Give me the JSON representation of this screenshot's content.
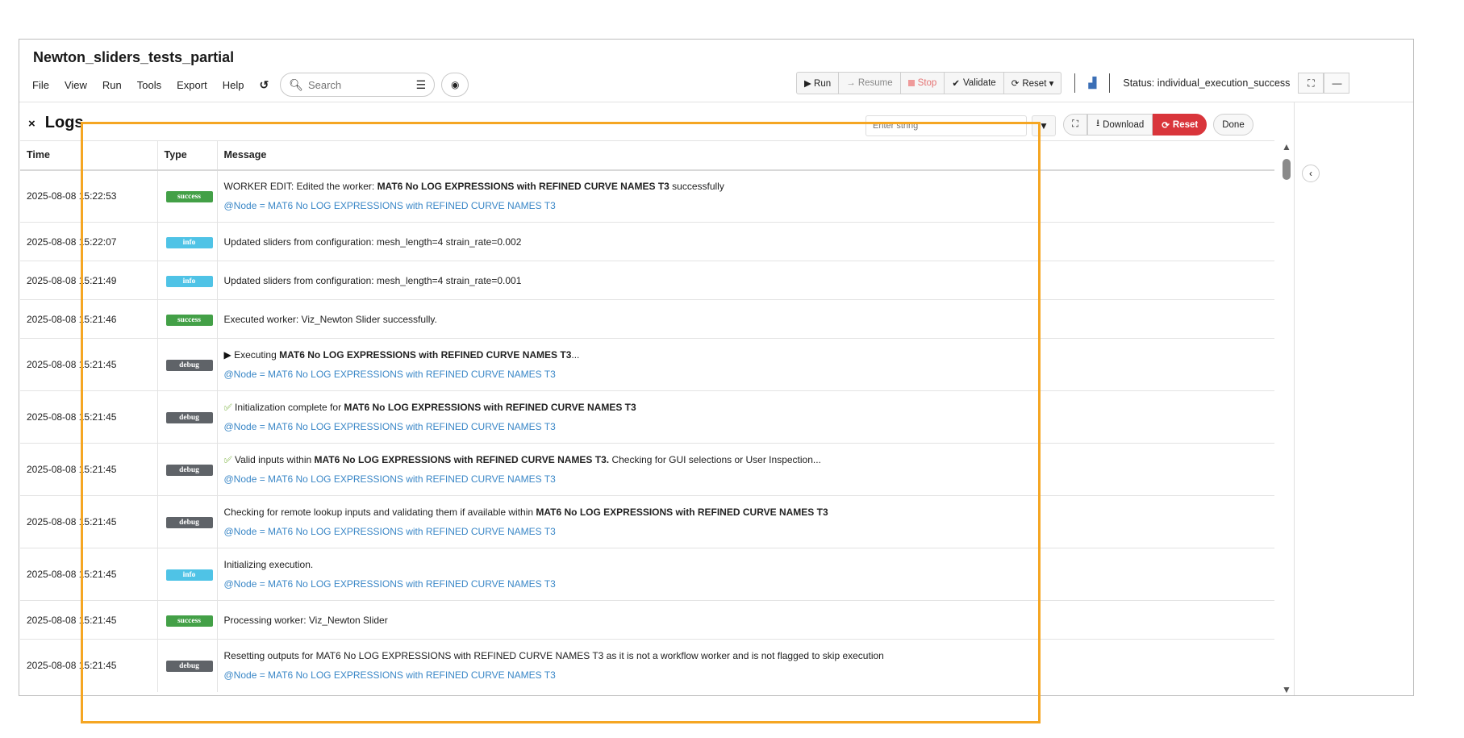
{
  "app": {
    "title": "Newton_sliders_tests_partial"
  },
  "menu": [
    "File",
    "View",
    "Run",
    "Tools",
    "Export",
    "Help"
  ],
  "search": {
    "placeholder": "Search"
  },
  "toolbar": {
    "run": "▶ Run",
    "resume": "→ Resume",
    "stop": "Stop",
    "validate": "Validate",
    "reset": "Reset ▾",
    "status": "Status: individual_execution_success"
  },
  "logs": {
    "title": "Logs",
    "filter_placeholder": "Enter string",
    "download": "Download",
    "reset": "Reset",
    "done": "Done",
    "columns": [
      "Time",
      "Type",
      "Message"
    ],
    "rows": [
      {
        "time": "2025-08-08 15:22:53",
        "type": "success",
        "icon": "",
        "pre": "WORKER EDIT: Edited the worker: ",
        "bold": "MAT6 No LOG EXPRESSIONS with REFINED CURVE NAMES T3",
        "post": " successfully",
        "node": "@Node = MAT6 No LOG EXPRESSIONS with REFINED CURVE NAMES T3"
      },
      {
        "time": "2025-08-08 15:22:07",
        "type": "info",
        "icon": "",
        "pre": "Updated sliders from configuration: mesh_length=4 strain_rate=0.002",
        "bold": "",
        "post": "",
        "node": ""
      },
      {
        "time": "2025-08-08 15:21:49",
        "type": "info",
        "icon": "",
        "pre": "Updated sliders from configuration: mesh_length=4 strain_rate=0.001",
        "bold": "",
        "post": "",
        "node": ""
      },
      {
        "time": "2025-08-08 15:21:46",
        "type": "success",
        "icon": "",
        "pre": "Executed worker: Viz_Newton Slider successfully.",
        "bold": "",
        "post": "",
        "node": ""
      },
      {
        "time": "2025-08-08 15:21:45",
        "type": "debug",
        "icon": "play",
        "pre": "Executing ",
        "bold": "MAT6 No LOG EXPRESSIONS with REFINED CURVE NAMES T3",
        "post": "...",
        "node": "@Node = MAT6 No LOG EXPRESSIONS with REFINED CURVE NAMES T3"
      },
      {
        "time": "2025-08-08 15:21:45",
        "type": "debug",
        "icon": "check",
        "pre": "Initialization complete for ",
        "bold": "MAT6 No LOG EXPRESSIONS with REFINED CURVE NAMES T3",
        "post": "",
        "node": "@Node = MAT6 No LOG EXPRESSIONS with REFINED CURVE NAMES T3"
      },
      {
        "time": "2025-08-08 15:21:45",
        "type": "debug",
        "icon": "check",
        "pre": "Valid inputs within ",
        "bold": "MAT6 No LOG EXPRESSIONS with REFINED CURVE NAMES T3.",
        "post": " Checking for GUI selections or User Inspection...",
        "node": "@Node = MAT6 No LOG EXPRESSIONS with REFINED CURVE NAMES T3"
      },
      {
        "time": "2025-08-08 15:21:45",
        "type": "debug",
        "icon": "",
        "pre": "Checking for remote lookup inputs and validating them if available within ",
        "bold": "MAT6 No LOG EXPRESSIONS with REFINED CURVE NAMES T3",
        "post": "",
        "node": "@Node = MAT6 No LOG EXPRESSIONS with REFINED CURVE NAMES T3"
      },
      {
        "time": "2025-08-08 15:21:45",
        "type": "info",
        "icon": "",
        "pre": "Initializing execution.",
        "bold": "",
        "post": "",
        "node": "@Node = MAT6 No LOG EXPRESSIONS with REFINED CURVE NAMES T3"
      },
      {
        "time": "2025-08-08 15:21:45",
        "type": "success",
        "icon": "",
        "pre": "Processing worker: Viz_Newton Slider",
        "bold": "",
        "post": "",
        "node": ""
      },
      {
        "time": "2025-08-08 15:21:45",
        "type": "debug",
        "icon": "",
        "pre": "Resetting outputs for MAT6 No LOG EXPRESSIONS with REFINED CURVE NAMES T3 as it is not a workflow worker and is not flagged to skip execution",
        "bold": "",
        "post": "",
        "node": "@Node = MAT6 No LOG EXPRESSIONS with REFINED CURVE NAMES T3"
      }
    ]
  },
  "colors": {
    "highlight": "#f5a623",
    "success": "#43a047",
    "info": "#4fc3e6",
    "debug": "#5f6368",
    "reset_red": "#d9353b",
    "node_link": "#3a87c7"
  }
}
